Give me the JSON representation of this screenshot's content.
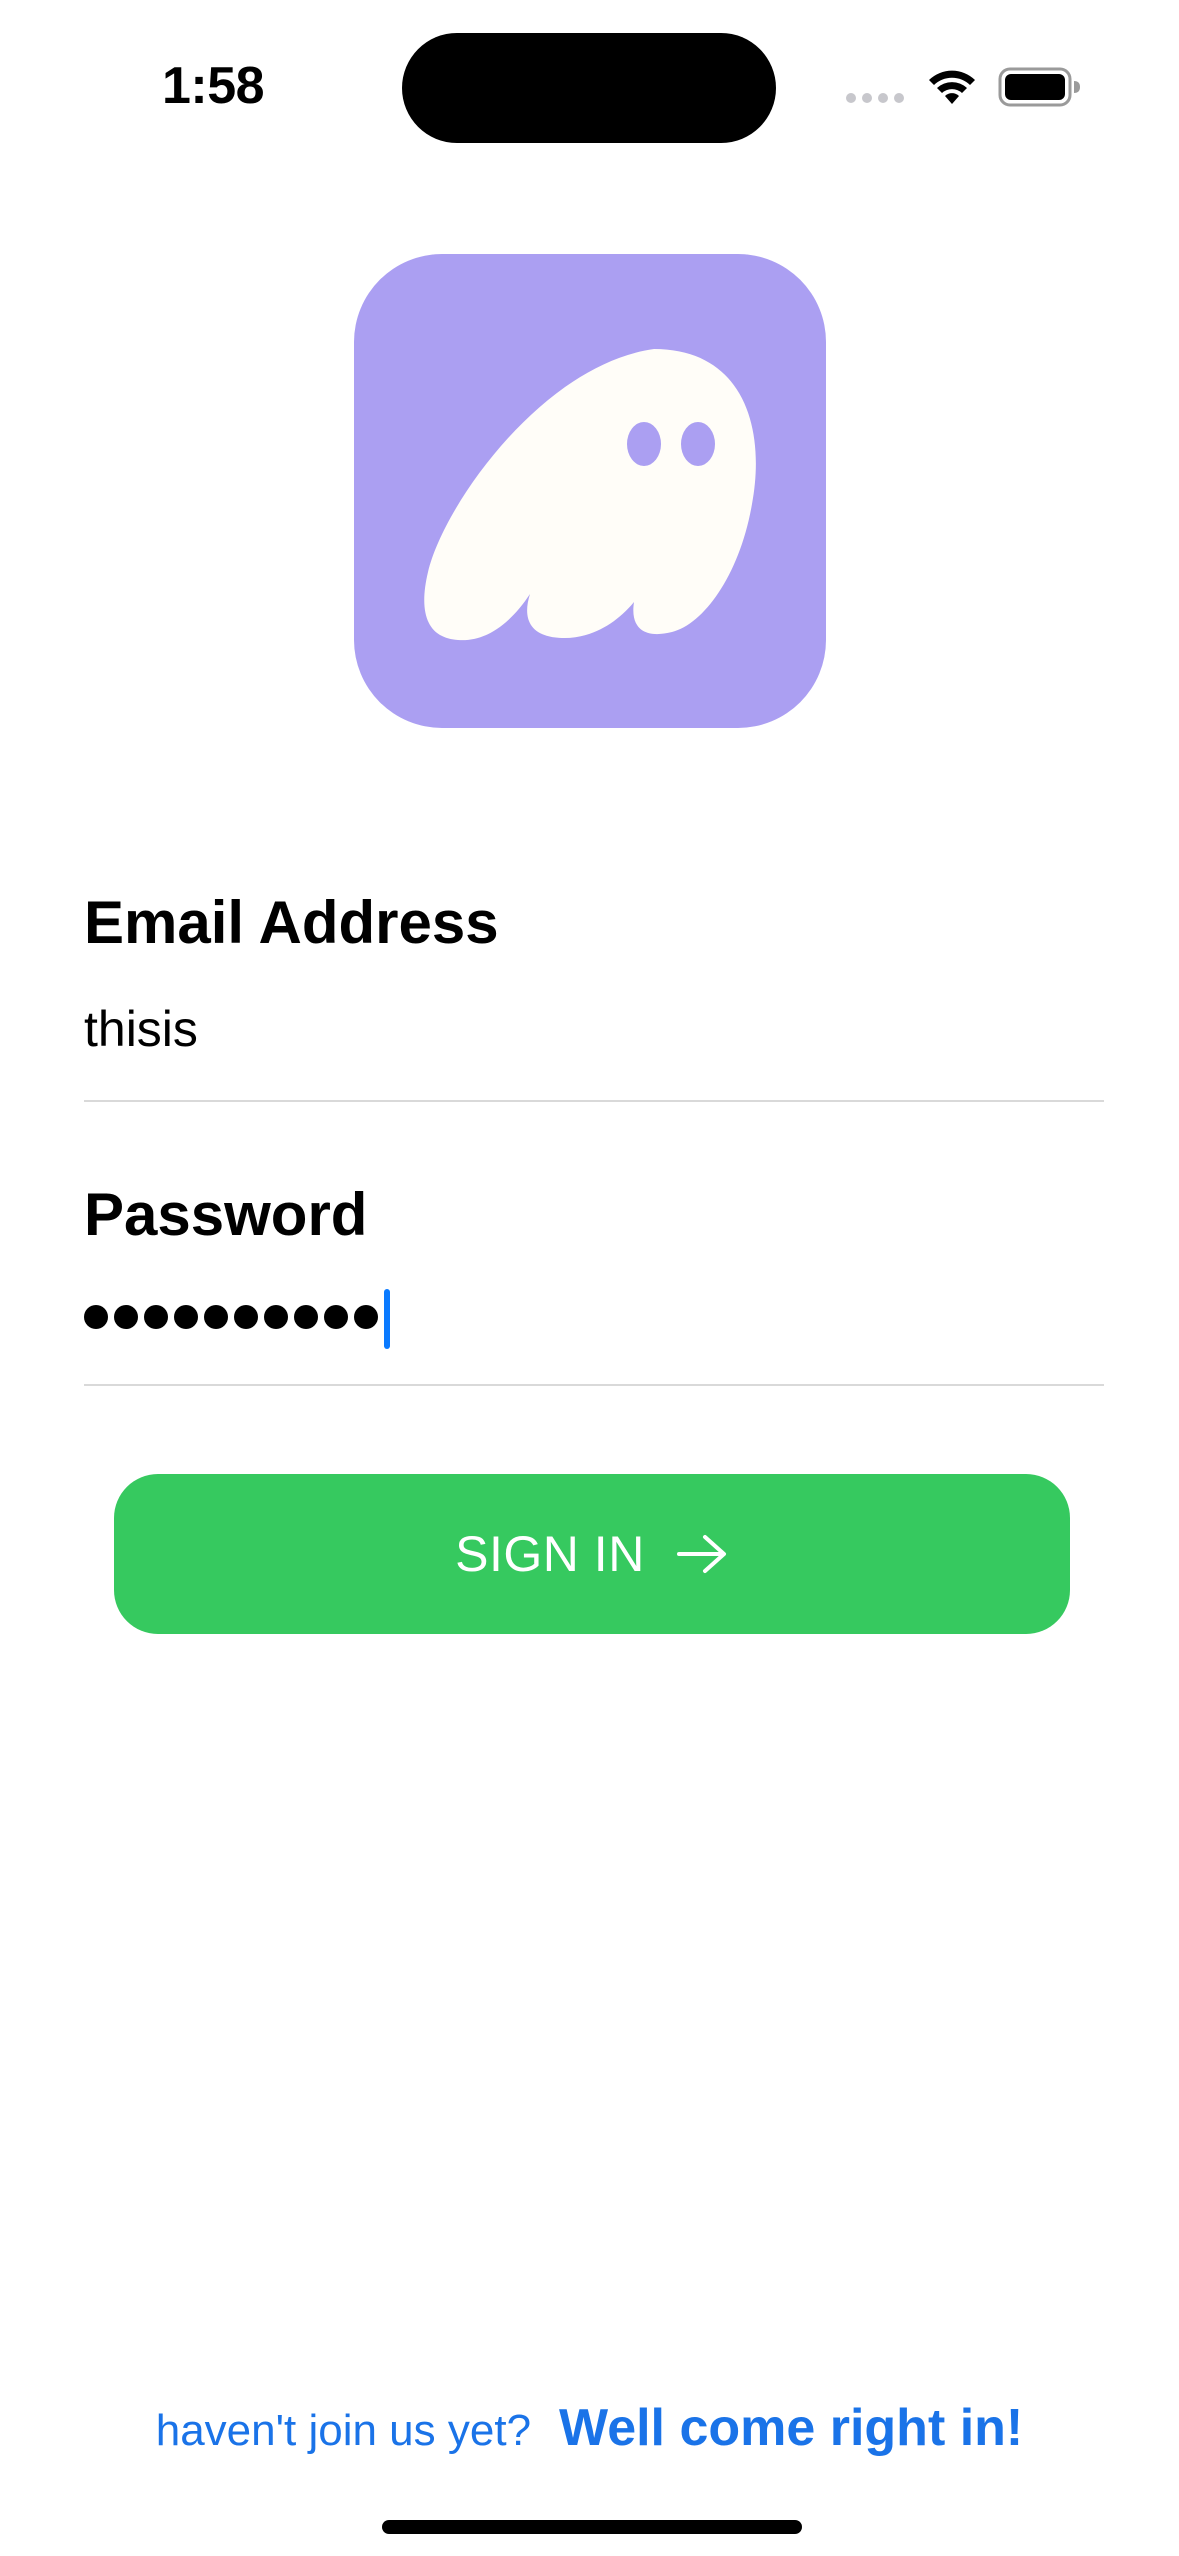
{
  "status_bar": {
    "time": "1:58",
    "icons": [
      "cellular-signal-icon",
      "wifi-icon",
      "battery-icon"
    ]
  },
  "logo": {
    "icon": "ghost-logo-icon",
    "background_color": "#ab9ff2",
    "ghost_color": "#fffdf8"
  },
  "form": {
    "email": {
      "label": "Email Address",
      "value": "thisis"
    },
    "password": {
      "label": "Password",
      "masked_value": "••••••••••",
      "character_count": 10,
      "cursor_color": "#0a7aff"
    }
  },
  "sign_in": {
    "label": "SIGN IN",
    "icon": "arrow-right-icon",
    "color": "#36c95f"
  },
  "footer": {
    "prompt": "haven't join us yet?",
    "link": "Well come right in!",
    "link_color": "#1a73e8"
  }
}
